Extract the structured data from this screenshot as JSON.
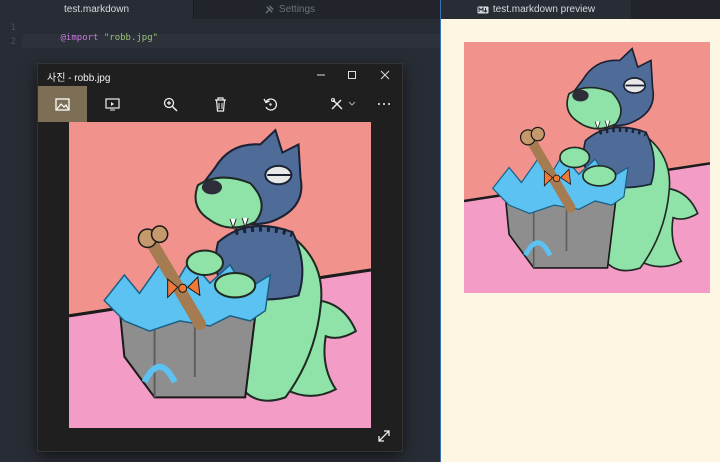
{
  "editor": {
    "tabs": [
      {
        "label": "test.markdown",
        "active": true
      },
      {
        "label": "Settings",
        "icon": "tools-icon",
        "active": false
      }
    ],
    "lines": [
      {
        "number": "1",
        "keyword": "@import",
        "string": "\"robb.jpg\""
      },
      {
        "number": "2",
        "keyword": "",
        "string": ""
      }
    ]
  },
  "photos_window": {
    "title": "사진 - robb.jpg",
    "toolbar": [
      {
        "name": "image-view-icon",
        "selected": true
      },
      {
        "name": "slideshow-icon"
      },
      {
        "name": "zoom-in-icon"
      },
      {
        "name": "delete-icon"
      },
      {
        "name": "rotate-icon"
      },
      {
        "name": "edit-icon"
      },
      {
        "name": "more-icon"
      }
    ],
    "image_alt": "robb.jpg"
  },
  "preview": {
    "tab_label": "test.markdown preview",
    "tab_icon": "markdown-icon"
  },
  "colors": {
    "editor_bg": "#282c34",
    "preview_bg": "#fdf6e3",
    "photo_bg": "#f2928c",
    "table_pink": "#f29cc6",
    "dog_green": "#8fe3a9",
    "shirt_blue": "#4f6c98",
    "box_gray": "#8e8e8e",
    "paper_blue": "#5cc2f2"
  }
}
